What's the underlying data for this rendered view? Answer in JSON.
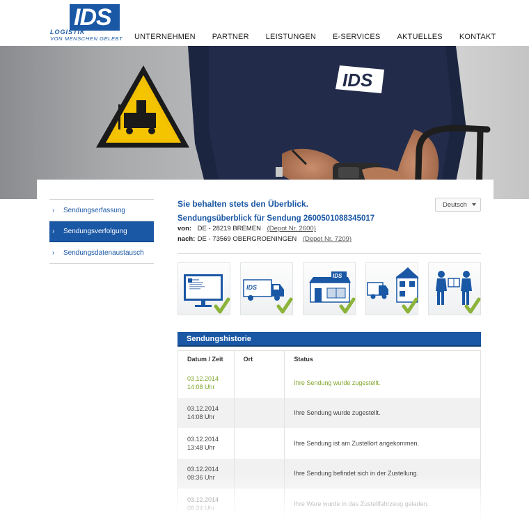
{
  "logo": {
    "brand": "IDS",
    "line1": "LOGISTIK",
    "line2": "VON MENSCHEN GELEBT"
  },
  "nav": [
    "UNTERNEHMEN",
    "PARTNER",
    "LEISTUNGEN",
    "E-SERVICES",
    "AKTUELLES",
    "KONTAKT"
  ],
  "hero": {
    "shirt_logo": "IDS",
    "sign": "forklift-warning-sign"
  },
  "sidebar": [
    {
      "label": "Sendungserfassung",
      "active": false
    },
    {
      "label": "Sendungsverfolgung",
      "active": true
    },
    {
      "label": "Sendungsdatenaustausch",
      "active": false
    }
  ],
  "main": {
    "headline": "Sie behalten stets den Überblick.",
    "language": "Deutsch",
    "subhead": "Sendungsüberblick für Sendung 2600501088345017",
    "from": {
      "label": "von:",
      "location": "DE - 28219 BREMEN",
      "depot": "(Depot Nr. 2600)"
    },
    "to": {
      "label": "nach:",
      "location": "DE - 73569 OBERGROENINGEN",
      "depot": "(Depot Nr. 7209)"
    }
  },
  "steps": [
    "order-entry",
    "truck-pickup",
    "depot-hub",
    "delivery-truck",
    "handover"
  ],
  "history": {
    "title": "Sendungshistorie",
    "columns": [
      "Datum / Zeit",
      "Ort",
      "Status"
    ],
    "rows": [
      {
        "date": "03.12.2014",
        "time": "14:08 Uhr",
        "place": "",
        "status": "Ihre Sendung wurde zugestellt."
      },
      {
        "date": "03.12.2014",
        "time": "14:08 Uhr",
        "place": "",
        "status": "Ihre Sendung wurde zugestellt."
      },
      {
        "date": "03.12.2014",
        "time": "13:48 Uhr",
        "place": "",
        "status": "Ihre Sendung ist am Zustellort angekommen."
      },
      {
        "date": "03.12.2014",
        "time": "08:36 Uhr",
        "place": "",
        "status": "Ihre Sendung befindet sich in der Zustellung."
      },
      {
        "date": "03.12.2014",
        "time": "08:24 Uhr",
        "place": "",
        "status": "Ihre Ware wurde in das Zustellfahrzeug geladen."
      }
    ]
  },
  "colors": {
    "brand": "#1a57a5",
    "check": "#8cb33a",
    "highlight": "#7fa52b"
  }
}
